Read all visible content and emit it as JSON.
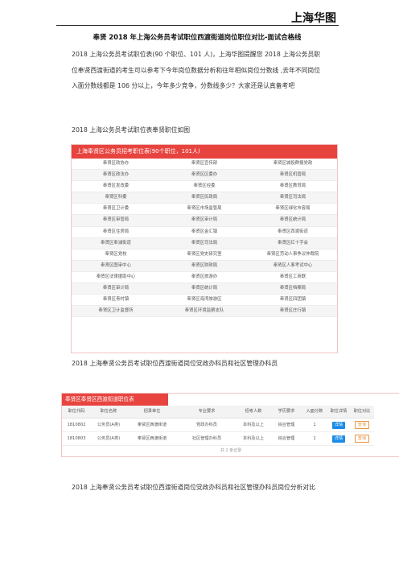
{
  "brand": "上海华图",
  "title": "奉贤 2018 年上海公务员考试职位西渡街道岗位职位对比-面试合格线",
  "paragraph": [
    "2018 上海公务员考试职位表(90 个职位、101 人)，上海华图提醒您 2018 上海公务员职",
    "位奉贤西渡街道的考生可以参考下今年岗位数据分析和往年相似岗位分数线 ,去年不同岗位",
    "入面分数线都是 106 分以上，今年多少竞争，分数线多少？大家还是认真备考吧"
  ],
  "caption1": "2018 上海公务员考试职位表奉贤职位如图",
  "caption2": "2018 上海奉贤公务员考试职位西渡街道岗位党政办科员和社区管理办科员",
  "caption3": "2018 上海奉贤公务员考试职位西渡街道岗位党政办科员和社区管理办科员岗位分析对比",
  "table1": {
    "header": "上海奉贤区公务员招考职位表(90个职位，101人)",
    "rows": [
      [
        "奉贤区政协办",
        "奉贤区宣传部",
        "奉贤区城投群报党政"
      ],
      [
        "奉贤区政法办",
        "奉贤区区委办",
        "奉贤区机管局"
      ],
      [
        "奉贤区发改委",
        "奉贤区经委",
        "奉贤区教育局"
      ],
      [
        "奉贤区科委",
        "奉贤区民政局",
        "奉贤区司法局"
      ],
      [
        "奉贤区卫计委",
        "奉贤区市场监管局",
        "奉贤区绿化市容局"
      ],
      [
        "奉贤区审管局",
        "奉贤区审计局",
        "奉贤区统计局"
      ],
      [
        "奉贤区住房局",
        "奉贤区金汇镇",
        "奉贤区西渡街道"
      ],
      [
        "奉贤区奉浦街道",
        "奉贤区司法局",
        "奉贤区红十字会"
      ],
      [
        "奉贤区党校",
        "奉贤区党史研究室",
        "奉贤区劳动人事争议仲裁院"
      ],
      [
        "奉贤区图审中心",
        "奉贤区财政局",
        "奉贤区人事考试中心"
      ],
      [
        "奉贤区法律援助中心",
        "奉贤区旅游办",
        "奉贤区工商联"
      ],
      [
        "奉贤区审计局",
        "奉贤区统计局",
        "奉贤区档案局"
      ],
      [
        "奉贤区青村镇",
        "奉贤区海湾旅游区",
        "奉贤区四团镇"
      ],
      [
        "奉贤区卫计监督所",
        "奉贤区环境监察支队",
        "奉贤区庄行镇"
      ]
    ]
  },
  "table2": {
    "header": "奉贤区奉贤区西渡街道职位表",
    "columns": [
      "职位代码",
      "职位名称",
      "招录单位",
      "专业要求",
      "招考人数",
      "学历要求",
      "入面分数",
      "职位详情",
      "职位对比"
    ],
    "rows": [
      [
        "1810802",
        "公务员(A类)",
        "奉贤区西渡街道",
        "党政办科员",
        "本科及以上",
        "综合管理",
        "1",
        "详情",
        "查询"
      ],
      [
        "1810803",
        "公务员(A类)",
        "奉贤区西渡街道",
        "社区管理办科员",
        "本科及以上",
        "综合管理",
        "1",
        "详情",
        "查询"
      ]
    ],
    "footer": "共 2 条记录"
  },
  "colors": {
    "accent": "#e8443f",
    "button_blue": "#1a8ce8",
    "button_orange": "#e8943f"
  }
}
